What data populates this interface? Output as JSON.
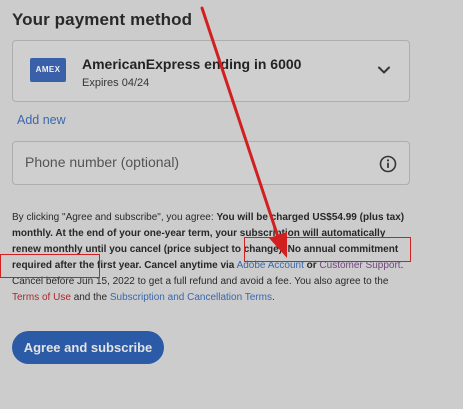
{
  "payment": {
    "title": "Your payment method",
    "card": {
      "brand_logo_text": "AMEX",
      "name": "AmericanExpress ending in 6000",
      "expiry": "Expires 04/24"
    },
    "add_new_label": "Add new"
  },
  "phone": {
    "placeholder": "Phone number (optional)"
  },
  "legal": {
    "intro": "By clicking \"Agree and subscribe\", you agree: ",
    "charge_bold": "You will be charged US$54.99 (plus tax) monthly. At the end of your one-year term, your subscription will automatically renew monthly until you cancel (price subject to change).",
    "commitment_bold_1": "No annual commitment required",
    "commitment_bold_2": "after the first year.",
    "cancel_bold": "Cancel anytime via",
    "adobe_account_link": "Adobe Account",
    "or_text": "or",
    "customer_support_link": "Customer Support",
    "refund_text": ". Cancel before Jun 15, 2022 to get a full refund and avoid a fee. You also agree to the",
    "terms_link": "Terms of Use",
    "and_text": "and the",
    "sub_terms_link": "Subscription and Cancellation Terms",
    "end_period": "."
  },
  "actions": {
    "subscribe_label": "Agree and subscribe"
  },
  "colors": {
    "accent_blue": "#2e60b2",
    "link_blue": "#3d6fb8",
    "annotation_red": "#e02222",
    "amex_blue": "#3f67b5"
  },
  "icons": {
    "chevron": "chevron-down-icon",
    "info": "info-icon"
  }
}
